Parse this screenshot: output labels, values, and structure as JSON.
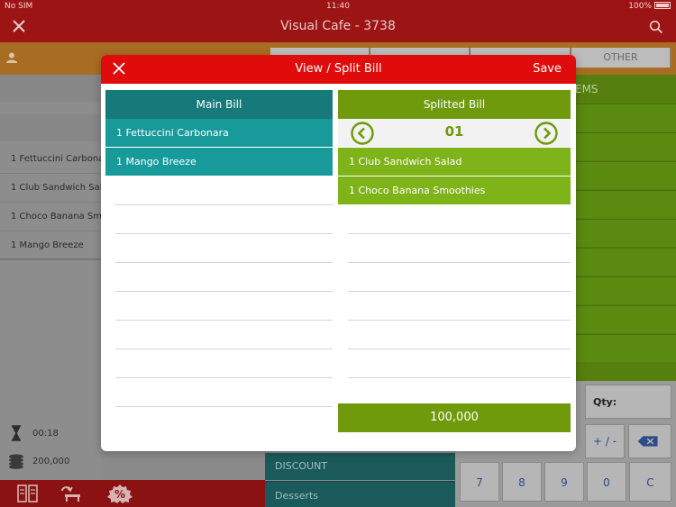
{
  "status_bar": {
    "carrier": "No SIM",
    "time": "11:40",
    "battery": "100%"
  },
  "header": {
    "title": "Visual Cafe - 3738"
  },
  "tabs": {
    "other_label": "OTHER"
  },
  "order_list": {
    "items": [
      "1 Fettuccini Carbonara",
      "1 Club Sandwich Salad",
      "1 Choco Banana Smoothies",
      "1 Mango Breeze"
    ]
  },
  "order_meta": {
    "duration": "00:18",
    "total": "200,000"
  },
  "right_panel": {
    "header_partial": "EMS"
  },
  "keypad": {
    "qty_label": "Qty:",
    "plus_minus": "+ / -",
    "keys": [
      "7",
      "8",
      "9",
      "0",
      "C"
    ]
  },
  "categories": {
    "discount": "DISCOUNT",
    "desserts": "Desserts"
  },
  "modal": {
    "title": "View / Split Bill",
    "save_label": "Save",
    "main_bill": {
      "header": "Main Bill",
      "items": [
        "1 Fettuccini Carbonara",
        "1 Mango Breeze"
      ]
    },
    "split_bill": {
      "header": "Splitted Bill",
      "page_number": "01",
      "items": [
        "1 Club Sandwich Salad",
        "1 Choco Banana Smoothies"
      ],
      "total": "100,000"
    }
  },
  "colors": {
    "header_red": "#e00c0c",
    "main_teal": "#167a7a",
    "split_green": "#6e9a0b"
  }
}
